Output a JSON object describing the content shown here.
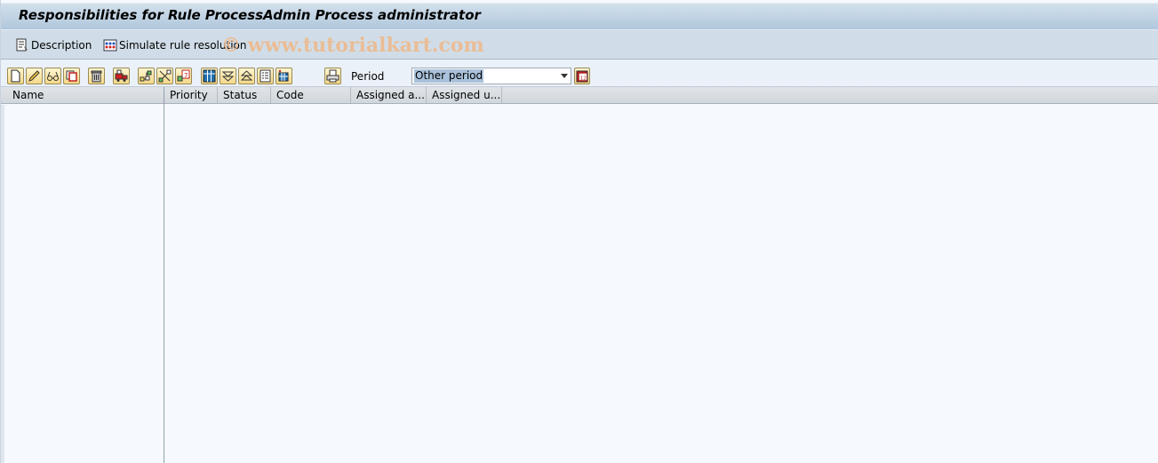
{
  "window": {
    "title": "Responsibilities for Rule ProcessAdmin Process administrator"
  },
  "app_toolbar": {
    "buttons": [
      {
        "label": "Description",
        "icon": "description-icon"
      },
      {
        "label": "Simulate rule resolution",
        "icon": "simulate-icon"
      }
    ],
    "watermark": "© www.tutorialkart.com"
  },
  "tree_toolbar": {
    "buttons": [
      {
        "name": "create",
        "icon": "new-document-icon"
      },
      {
        "name": "change",
        "icon": "pencil-icon"
      },
      {
        "name": "display",
        "icon": "glasses-icon"
      },
      {
        "name": "copy",
        "icon": "copy-icon"
      },
      {
        "name": "delete",
        "icon": "trash-icon"
      },
      {
        "name": "transport",
        "icon": "truck-icon"
      },
      {
        "name": "hierarchy",
        "icon": "hierarchy-icon"
      },
      {
        "name": "cut",
        "icon": "scissors-icon"
      },
      {
        "name": "validity",
        "icon": "calendar-icon"
      },
      {
        "name": "layout",
        "icon": "columns-icon"
      },
      {
        "name": "expand",
        "icon": "expand-icon"
      },
      {
        "name": "collapse",
        "icon": "collapse-icon"
      },
      {
        "name": "details",
        "icon": "details-icon"
      },
      {
        "name": "column-config",
        "icon": "column-settings-icon"
      },
      {
        "name": "print",
        "icon": "print-icon"
      }
    ],
    "period_label": "Period",
    "period_value": "Other period"
  },
  "table": {
    "columns": [
      "Name",
      "Priority",
      "Status",
      "Code",
      "Assigned a...",
      "Assigned u..."
    ],
    "rows": []
  },
  "colors": {
    "title_bar": "#b0c7dc",
    "app_bar": "#d0dde8",
    "toolbar": "#ebf1f8",
    "button_fill": "#f4d889",
    "selection": "#a9c1da",
    "content_bg": "#f6f9fd"
  }
}
